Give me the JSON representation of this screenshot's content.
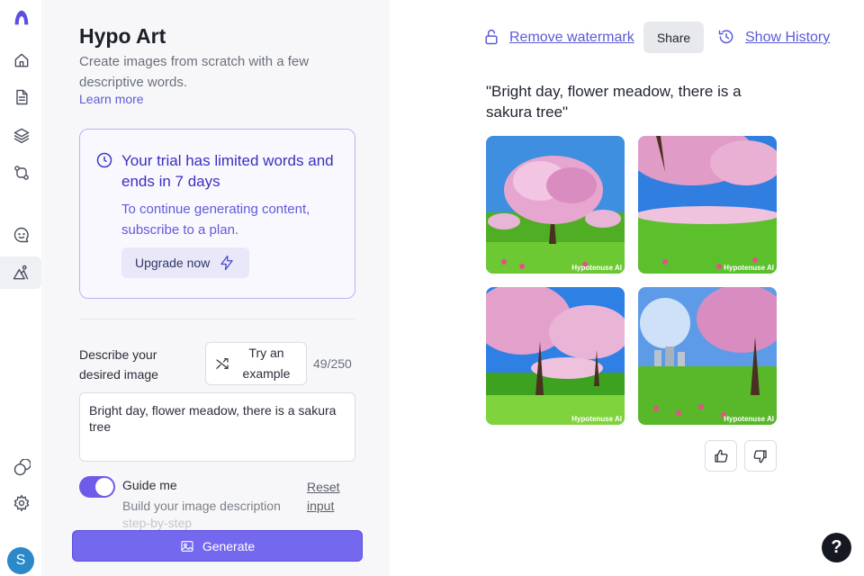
{
  "sidebar": {
    "icons": [
      "logo-icon",
      "home-icon",
      "document-icon",
      "layers-icon",
      "git-compare-icon",
      "chat-icon",
      "art-icon",
      "circles-icon",
      "gear-icon"
    ],
    "avatar_initial": "S"
  },
  "panel": {
    "title": "Hypo Art",
    "subtitle": "Create images from scratch with a few descriptive words.",
    "learn_more": "Learn more",
    "trial": {
      "heading": "Your trial has limited words and ends in 7 days",
      "body": "To continue generating content, subscribe to a plan.",
      "upgrade_label": "Upgrade now"
    },
    "describe_label": "Describe your desired image",
    "try_example_label": "Try an example",
    "char_count": "49/250",
    "prompt_value": "Bright day, flower meadow, there is a sakura tree",
    "guide_label": "Guide me",
    "guide_sub": "Build your image description",
    "guide_sub_faded": "step-by-step",
    "reset_label": "Reset input",
    "generate_label": "Generate",
    "toggle_on": true
  },
  "results": {
    "remove_watermark": "Remove watermark",
    "share": "Share",
    "show_history": "Show History",
    "prompt_quote": "\"Bright day, flower meadow, there is a sakura tree\"",
    "watermark": "Hypotenuse AI",
    "image_count": 4
  },
  "colors": {
    "accent": "#7468ef",
    "link": "#5b5bd6",
    "trial_text": "#3a2fc2"
  },
  "help_label": "?"
}
